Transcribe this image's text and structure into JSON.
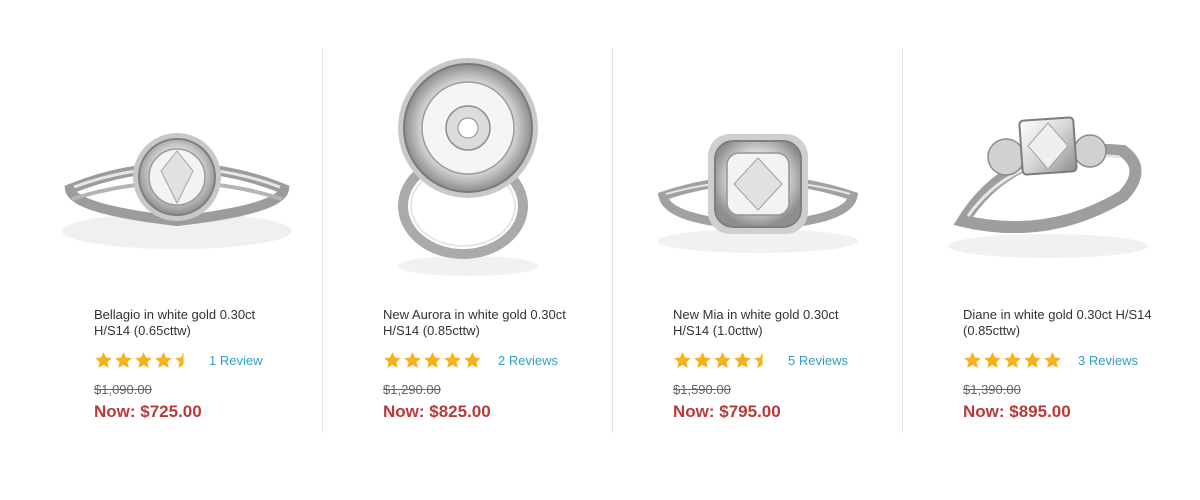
{
  "colors": {
    "star": "#f5b21c",
    "link": "#2f9fc4",
    "sale_price": "#b83a3a",
    "divider": "#d9e7ee"
  },
  "products": [
    {
      "image_icon": "ring-halo-split-shank-icon",
      "title": "Bellagio in white gold 0.30ct H/S14 (0.65cttw)",
      "rating": 4.5,
      "reviews_label": "1 Review",
      "old_price": "$1,090.00",
      "now_price": "Now: $725.00"
    },
    {
      "image_icon": "ring-starburst-halo-icon",
      "title": "New Aurora in white gold 0.30ct H/S14 (0.85cttw)",
      "rating": 5,
      "reviews_label": "2 Reviews",
      "old_price": "$1,290.00",
      "now_price": "Now: $825.00"
    },
    {
      "image_icon": "ring-cushion-halo-icon",
      "title": "New Mia in white gold 0.30ct H/S14 (1.0cttw)",
      "rating": 4.5,
      "reviews_label": "5 Reviews",
      "old_price": "$1,590.00",
      "now_price": "Now: $795.00"
    },
    {
      "image_icon": "ring-three-stone-icon",
      "title": "Diane in white gold 0.30ct H/S14 (0.85cttw)",
      "rating": 5,
      "reviews_label": "3 Reviews",
      "old_price": "$1,390.00",
      "now_price": "Now: $895.00"
    }
  ]
}
